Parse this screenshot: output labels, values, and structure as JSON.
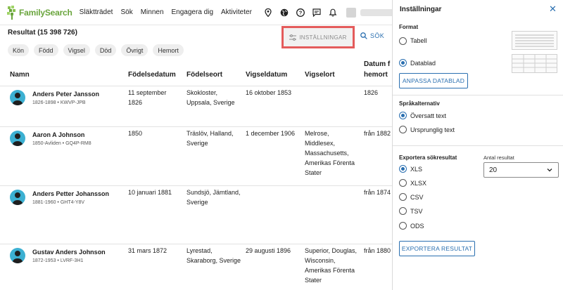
{
  "nav": {
    "logo_text": "FamilySearch",
    "items": [
      "Släktträdet",
      "Sök",
      "Minnen",
      "Engagera dig",
      "Aktiviteter"
    ],
    "icons": [
      "map-pin-icon",
      "globe-icon",
      "help-icon",
      "messages-icon",
      "bell-icon"
    ]
  },
  "results": {
    "count_label": "Resultat (15 398 726)",
    "settings_label": "INSTÄLLNINGAR",
    "search_label": "SÖK",
    "filters": [
      "Kön",
      "Född",
      "Vigsel",
      "Död",
      "Övrigt",
      "Hemort"
    ]
  },
  "table": {
    "headers": [
      "Namn",
      "Födelsedatum",
      "Födelseort",
      "Vigseldatum",
      "Vigselort",
      "Datum f",
      "hemort"
    ],
    "rows": [
      {
        "name": "Anders Peter Jansson",
        "meta": "1826-1898 • KWVP-JPB",
        "birth_date": [
          "11 september",
          "1826"
        ],
        "birth_place": [
          "Skokloster,",
          "Uppsala, Sverige"
        ],
        "marriage_date": [
          "16 oktober 1853"
        ],
        "marriage_place": [],
        "residence_date": [
          "1826"
        ]
      },
      {
        "name": "Aaron A Johnson",
        "meta": "1850-Avliden • GQ4P-RM8",
        "birth_date": [
          "1850"
        ],
        "birth_place": [
          "Träslöv, Halland,",
          "Sverige"
        ],
        "marriage_date": [
          "1 december 1906"
        ],
        "marriage_place": [
          "Melrose,",
          "Middlesex,",
          "Massachusetts,",
          "Amerikas Förenta",
          "Stater"
        ],
        "residence_date": [
          "från 1882"
        ]
      },
      {
        "name": "Anders Petter Johansson",
        "meta": "1881-1960 • GHT4-Y8V",
        "birth_date": [
          "10 januari 1881"
        ],
        "birth_place": [
          "Sundsjö, Jämtland,",
          "Sverige"
        ],
        "marriage_date": [],
        "marriage_place": [],
        "residence_date": [
          "från 1874"
        ]
      },
      {
        "name": "Gustav Anders Johnson",
        "meta": "1872-1953 • LVRF-3H1",
        "birth_date": [
          "31 mars 1872"
        ],
        "birth_place": [
          "Lyrestad,",
          "Skaraborg, Sverige"
        ],
        "marriage_date": [
          "29 augusti 1896"
        ],
        "marriage_place": [
          "Superior, Douglas,",
          "Wisconsin,",
          "Amerikas Förenta",
          "Stater"
        ],
        "residence_date": [
          "från 1880"
        ]
      }
    ]
  },
  "panel": {
    "title": "Inställningar",
    "format_title": "Format",
    "format_options": [
      "Tabell",
      "Datablad"
    ],
    "format_selected": "Datablad",
    "customize_button": "ANPASSA DATABLAD",
    "language_title": "Språkalternativ",
    "language_options": [
      "Översatt text",
      "Ursprunglig text"
    ],
    "language_selected": "Översatt text",
    "export_title": "Exportera sökresultat",
    "export_options": [
      "XLS",
      "XLSX",
      "CSV",
      "TSV",
      "ODS"
    ],
    "export_selected": "XLS",
    "count_label": "Antal resultat",
    "count_value": "20",
    "export_button": "EXPORTERA RESULTAT"
  },
  "colors": {
    "brand_green": "#6aa53d",
    "link_blue": "#2a6fb0",
    "highlight_red": "#e45b5b",
    "avatar_blue": "#3cb0d2"
  }
}
